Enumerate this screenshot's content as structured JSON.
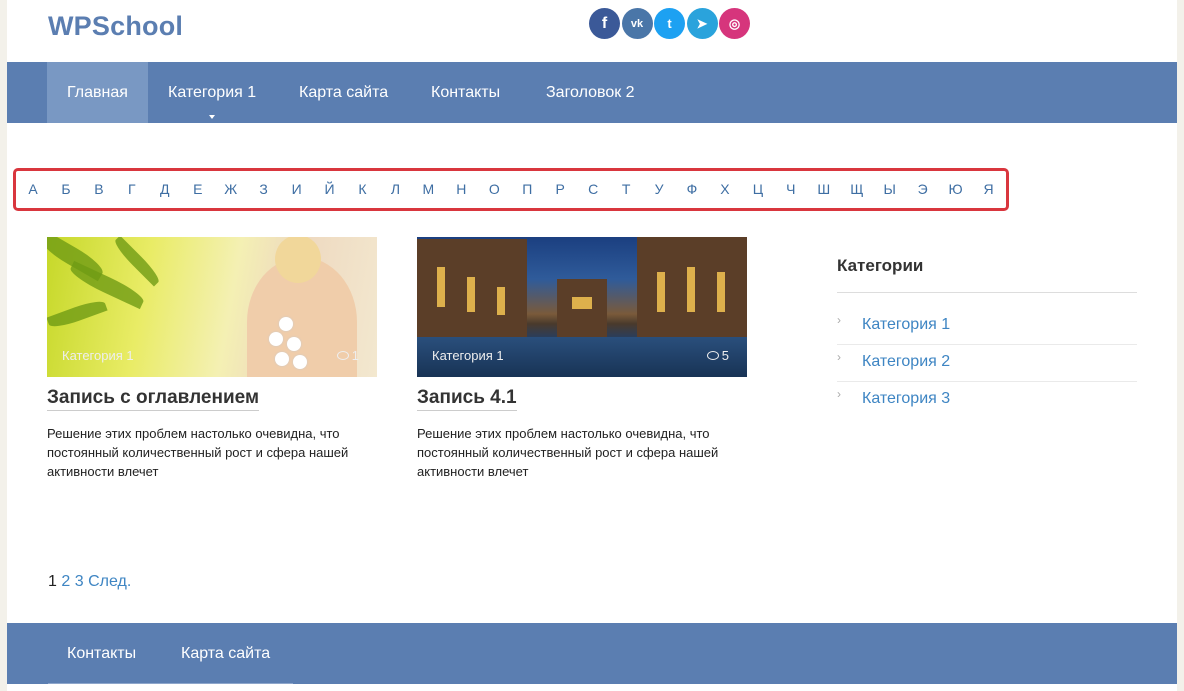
{
  "site": {
    "logo": "WPSchool"
  },
  "social": [
    {
      "name": "facebook",
      "glyph": "f",
      "color": "#3b5998"
    },
    {
      "name": "vk",
      "glyph": "vk",
      "color": "#4a76a8"
    },
    {
      "name": "twitter",
      "glyph": "t",
      "color": "#1da1f2"
    },
    {
      "name": "telegram",
      "glyph": "➤",
      "color": "#2aa3dc"
    },
    {
      "name": "instagram",
      "glyph": "◎",
      "color": "#d6357c"
    }
  ],
  "nav": {
    "items": [
      {
        "label": "Главная",
        "active": true
      },
      {
        "label": "Категория 1",
        "has_submenu": true
      },
      {
        "label": "Карта сайта"
      },
      {
        "label": "Контакты"
      },
      {
        "label": "Заголовок 2"
      }
    ]
  },
  "alphabet": [
    "А",
    "Б",
    "В",
    "Г",
    "Д",
    "Е",
    "Ж",
    "З",
    "И",
    "Й",
    "К",
    "Л",
    "М",
    "Н",
    "О",
    "П",
    "Р",
    "С",
    "Т",
    "У",
    "Ф",
    "Х",
    "Ц",
    "Ч",
    "Ш",
    "Щ",
    "Ы",
    "Э",
    "Ю",
    "Я"
  ],
  "posts": [
    {
      "category": "Категория 1",
      "comments": "1",
      "title": "Запись с оглавлением",
      "excerpt": "Решение этих проблем настолько очевидна, что постоянный количественный рост и сфера нашей активности влечет"
    },
    {
      "category": "Категория 1",
      "comments": "5",
      "title": "Запись 4.1",
      "excerpt": "Решение этих проблем настолько очевидна, что постоянный количественный рост и сфера нашей активности влечет"
    }
  ],
  "sidebar": {
    "title": "Категории",
    "items": [
      "Категория 1",
      "Категория 2",
      "Категория 3"
    ]
  },
  "pagination": {
    "current": "1",
    "pages": [
      "2",
      "3"
    ],
    "next": "След."
  },
  "footer": {
    "items": [
      "Контакты",
      "Карта сайта"
    ]
  },
  "colors": {
    "brand": "#5b7eb1",
    "link": "#3e85c3",
    "highlight_border": "#d9363e"
  }
}
